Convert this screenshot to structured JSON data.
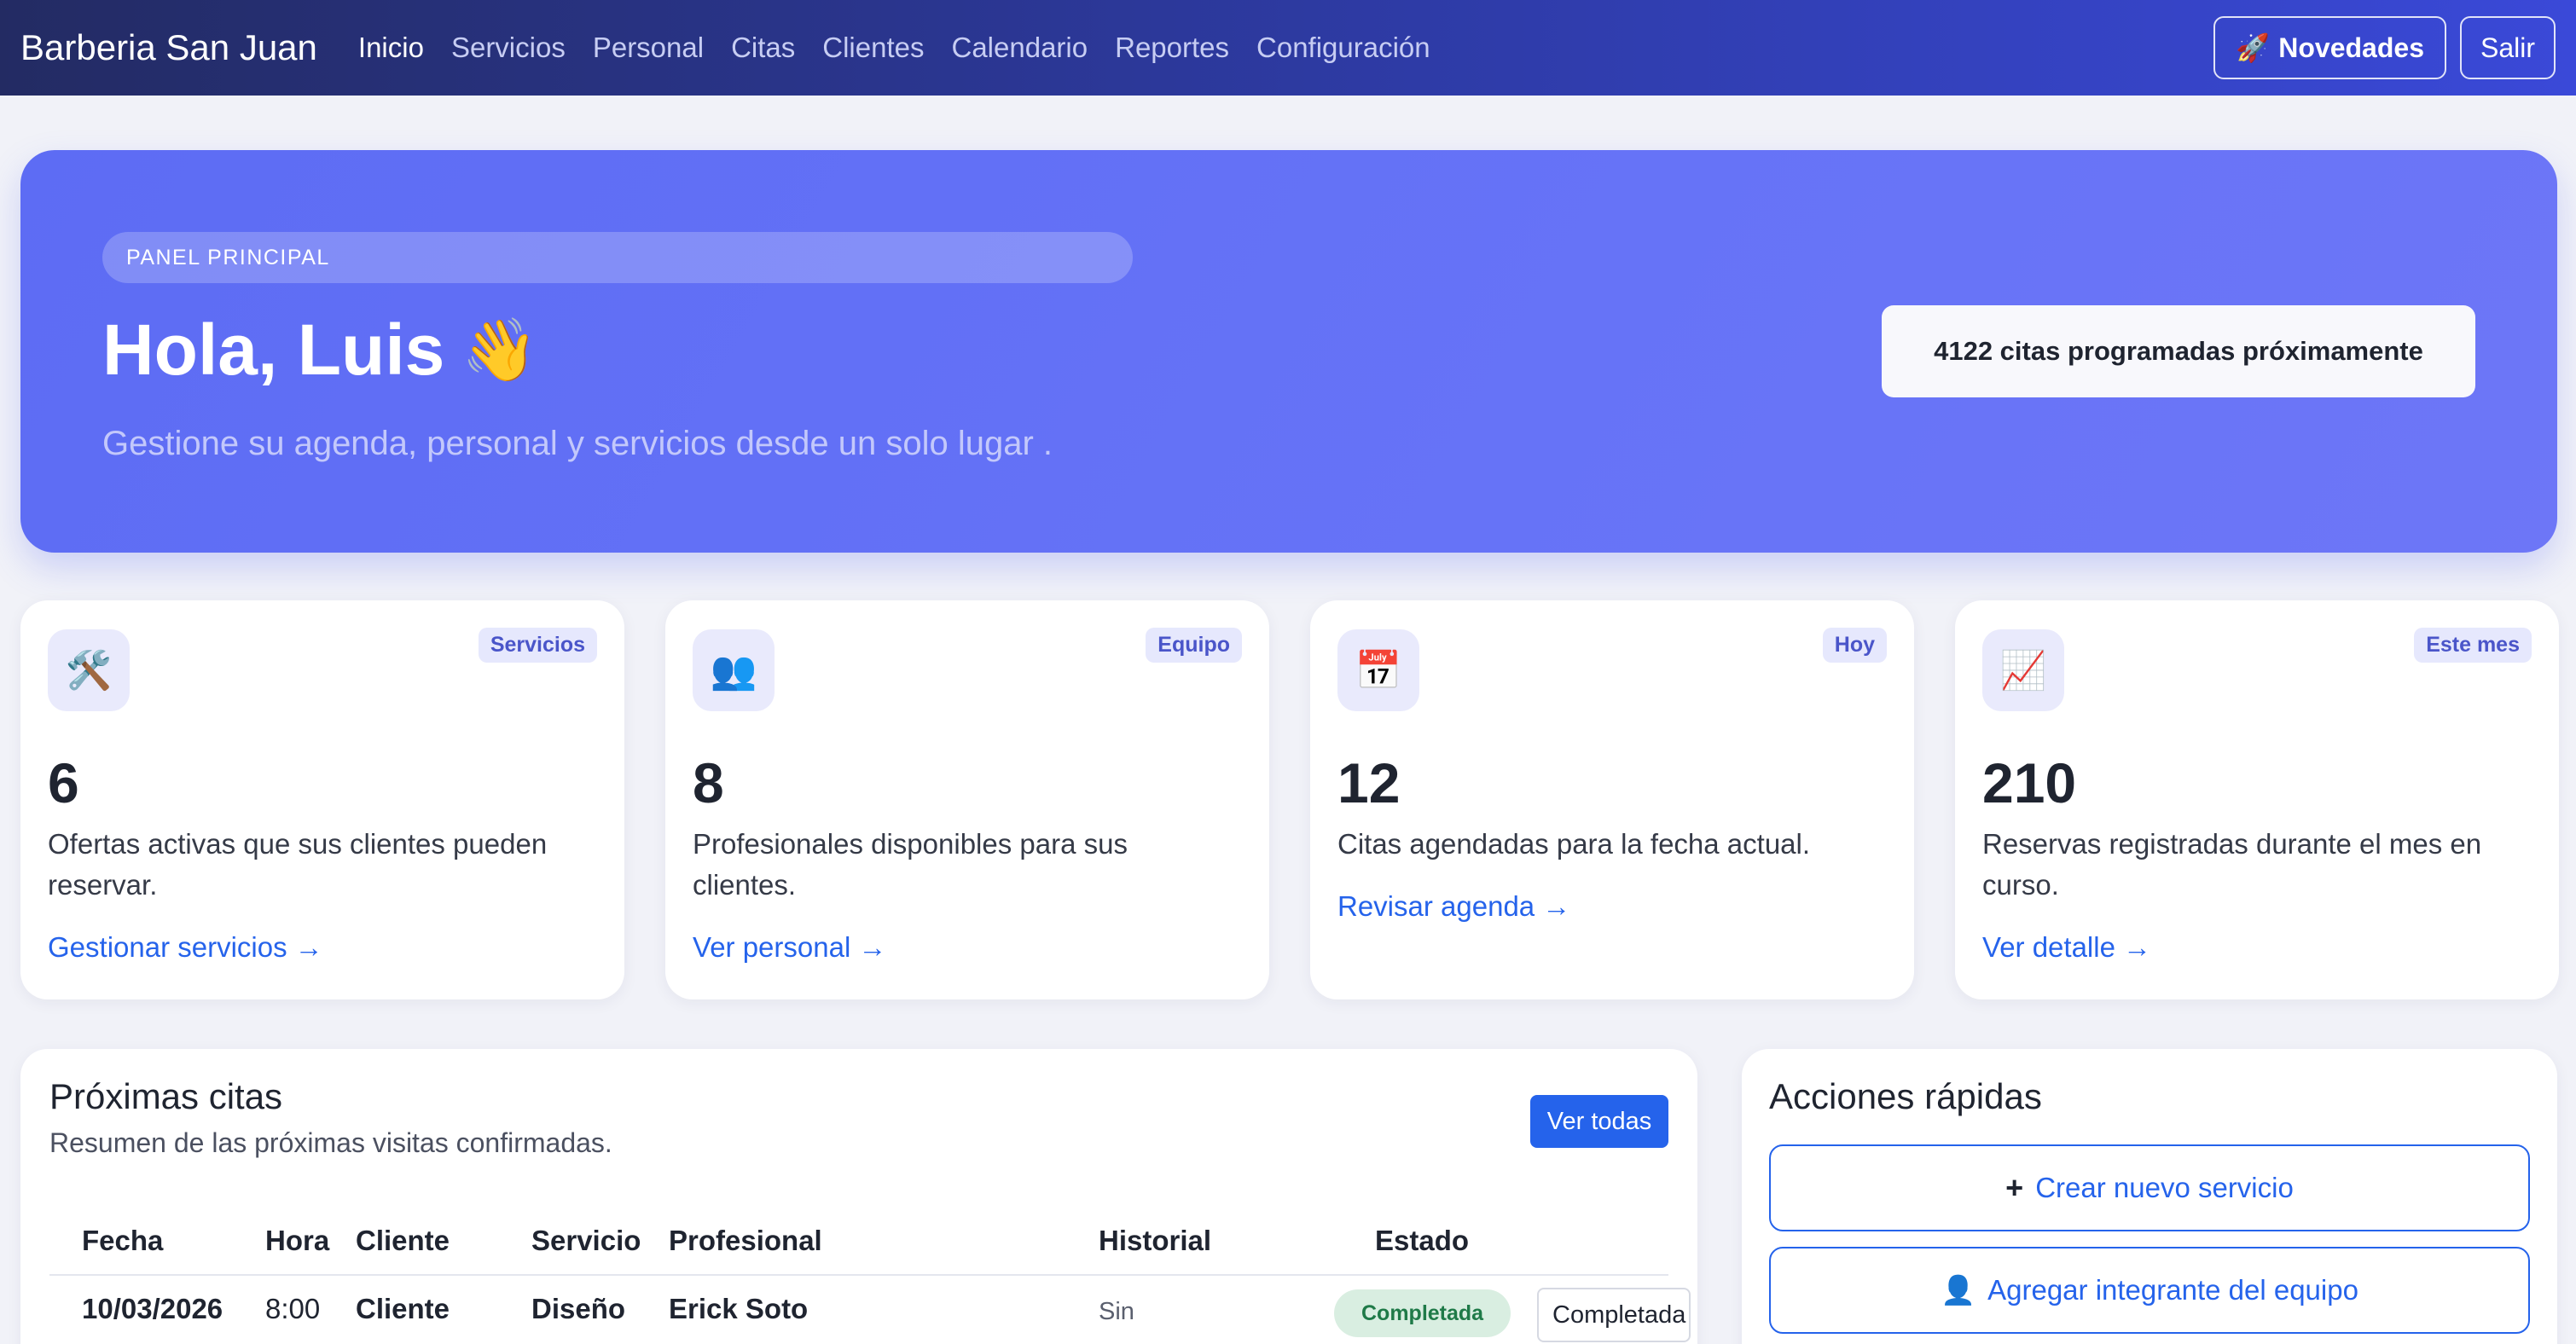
{
  "nav": {
    "brand": "Barberia San Juan",
    "links": [
      "Inicio",
      "Servicios",
      "Personal",
      "Citas",
      "Clientes",
      "Calendario",
      "Reportes",
      "Configuración"
    ],
    "novedades_label": "Novedades",
    "salir_label": "Salir"
  },
  "hero": {
    "tag": "PANEL PRINCIPAL",
    "title": "Hola, Luis",
    "subtitle": "Gestione su agenda, personal y servicios desde un solo lugar .",
    "upcoming": "4122 citas programadas próximamente"
  },
  "stats": [
    {
      "icon": "tools-icon",
      "badge": "Servicios",
      "value": "6",
      "desc": "Ofertas activas que sus clientes pueden reservar.",
      "link": "Gestionar servicios →"
    },
    {
      "icon": "team-icon",
      "badge": "Equipo",
      "value": "8",
      "desc": "Profesionales disponibles para sus clientes.",
      "link": "Ver personal →"
    },
    {
      "icon": "calendar-icon",
      "badge": "Hoy",
      "value": "12",
      "desc": "Citas agendadas para la fecha actual.",
      "link": "Revisar agenda →"
    },
    {
      "icon": "chart-icon",
      "badge": "Este mes",
      "value": "210",
      "desc": "Reservas registradas durante el mes en curso.",
      "link": "Ver detalle →"
    }
  ],
  "appointments": {
    "title": "Próximas citas",
    "subtitle": "Resumen de las próximas visitas confirmadas.",
    "view_all": "Ver todas",
    "columns": [
      "Fecha",
      "Hora",
      "Cliente",
      "Servicio",
      "Profesional",
      "Historial",
      "Estado"
    ],
    "rows": [
      {
        "fecha": "10/03/2026",
        "hora": "8:00",
        "cliente": "Cliente",
        "servicio": "Diseño",
        "profesional": "Erick Soto",
        "historial": "Sin",
        "estado": "Completada",
        "estado_select": "Completada"
      }
    ]
  },
  "quick_actions": {
    "title": "Acciones rápidas",
    "items": [
      {
        "icon": "plus-icon",
        "label": "Crear nuevo servicio"
      },
      {
        "icon": "user-icon",
        "label": "Agregar integrante del equipo"
      }
    ]
  },
  "colors": {
    "accent": "#2563eb",
    "hero": "#6470f6",
    "nav": "#2e3ba6",
    "success": "#1f7a48"
  }
}
